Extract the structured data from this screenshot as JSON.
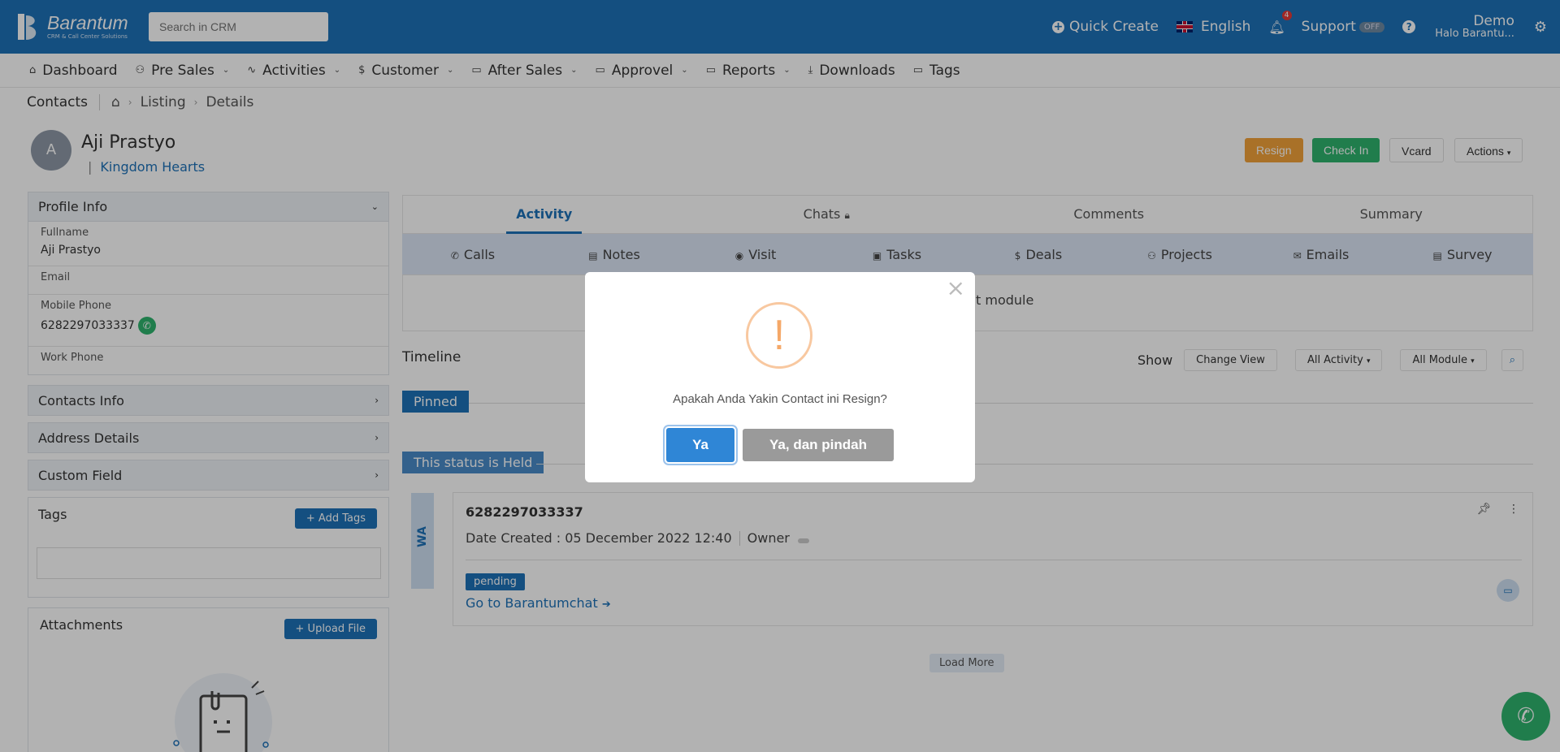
{
  "header": {
    "brand_name": "Barantum",
    "brand_tagline": "CRM & Call Center Solutions",
    "search_placeholder": "Search in CRM",
    "quick_create": "Quick Create",
    "language": "English",
    "notification_count": "4",
    "support": "Support",
    "support_toggle": "OFF",
    "user_name": "Demo",
    "user_org": "Halo Barantu..."
  },
  "nav": [
    {
      "label": "Dashboard",
      "icon": "home-icon",
      "glyph": "⌂",
      "dropdown": false
    },
    {
      "label": "Pre Sales",
      "icon": "users-icon",
      "glyph": "⚇",
      "dropdown": true
    },
    {
      "label": "Activities",
      "icon": "activity-icon",
      "glyph": "∿",
      "dropdown": true
    },
    {
      "label": "Customer",
      "icon": "dollar-icon",
      "glyph": "$",
      "dropdown": true
    },
    {
      "label": "After Sales",
      "icon": "folder-icon",
      "glyph": "▭",
      "dropdown": true
    },
    {
      "label": "Approvel",
      "icon": "folder-icon",
      "glyph": "▭",
      "dropdown": true
    },
    {
      "label": "Reports",
      "icon": "folder-icon",
      "glyph": "▭",
      "dropdown": true
    },
    {
      "label": "Downloads",
      "icon": "download-icon",
      "glyph": "⤓",
      "dropdown": false
    },
    {
      "label": "Tags",
      "icon": "folder-icon",
      "glyph": "▭",
      "dropdown": false
    }
  ],
  "breadcrumb": {
    "title": "Contacts",
    "items": [
      "Listing",
      "Details"
    ]
  },
  "profile": {
    "initial": "A",
    "name": "Aji Prastyo",
    "company": "Kingdom Hearts",
    "buttons": {
      "resign": "Resign",
      "checkin": "Check In",
      "vcard": "Vcard",
      "actions": "Actions"
    }
  },
  "profile_info": {
    "title": "Profile Info",
    "fields": [
      {
        "label": "Fullname",
        "value": "Aji Prastyo"
      },
      {
        "label": "Email",
        "value": ""
      },
      {
        "label": "Mobile Phone",
        "value": "6282297033337"
      },
      {
        "label": "Work Phone",
        "value": ""
      }
    ]
  },
  "sections": [
    "Contacts Info",
    "Address Details",
    "Custom Field"
  ],
  "tags": {
    "title": "Tags",
    "add_label": "+ Add Tags"
  },
  "attachments": {
    "title": "Attachments",
    "upload_label": "+ Upload File"
  },
  "tabs": [
    "Activity",
    "Chats",
    "Comments",
    "Summary"
  ],
  "subtabs": [
    {
      "label": "Calls",
      "glyph": "✆"
    },
    {
      "label": "Notes",
      "glyph": "▤"
    },
    {
      "label": "Visit",
      "glyph": "◉"
    },
    {
      "label": "Tasks",
      "glyph": "▣"
    },
    {
      "label": "Deals",
      "glyph": "$"
    },
    {
      "label": "Projects",
      "glyph": "⚇"
    },
    {
      "label": "Emails",
      "glyph": "✉"
    },
    {
      "label": "Survey",
      "glyph": "▤"
    }
  ],
  "module_hint": "t module",
  "timeline": {
    "title": "Timeline",
    "show_label": "Show",
    "change_view": "Change View",
    "all_activity": "All Activity",
    "all_module": "All Module",
    "pinned": "Pinned",
    "status_held": "This status is Held",
    "channel": "WA",
    "card": {
      "title": "6282297033337",
      "date_label": "Date Created :",
      "date_value": "05 December 2022 12:40",
      "owner_label": "Owner",
      "status": "pending",
      "link": "Go to Barantumchat"
    },
    "load_more": "Load More"
  },
  "modal": {
    "icon": "!",
    "message": "Apakah Anda Yakin Contact ini Resign?",
    "confirm": "Ya",
    "confirm_move": "Ya, dan pindah"
  }
}
